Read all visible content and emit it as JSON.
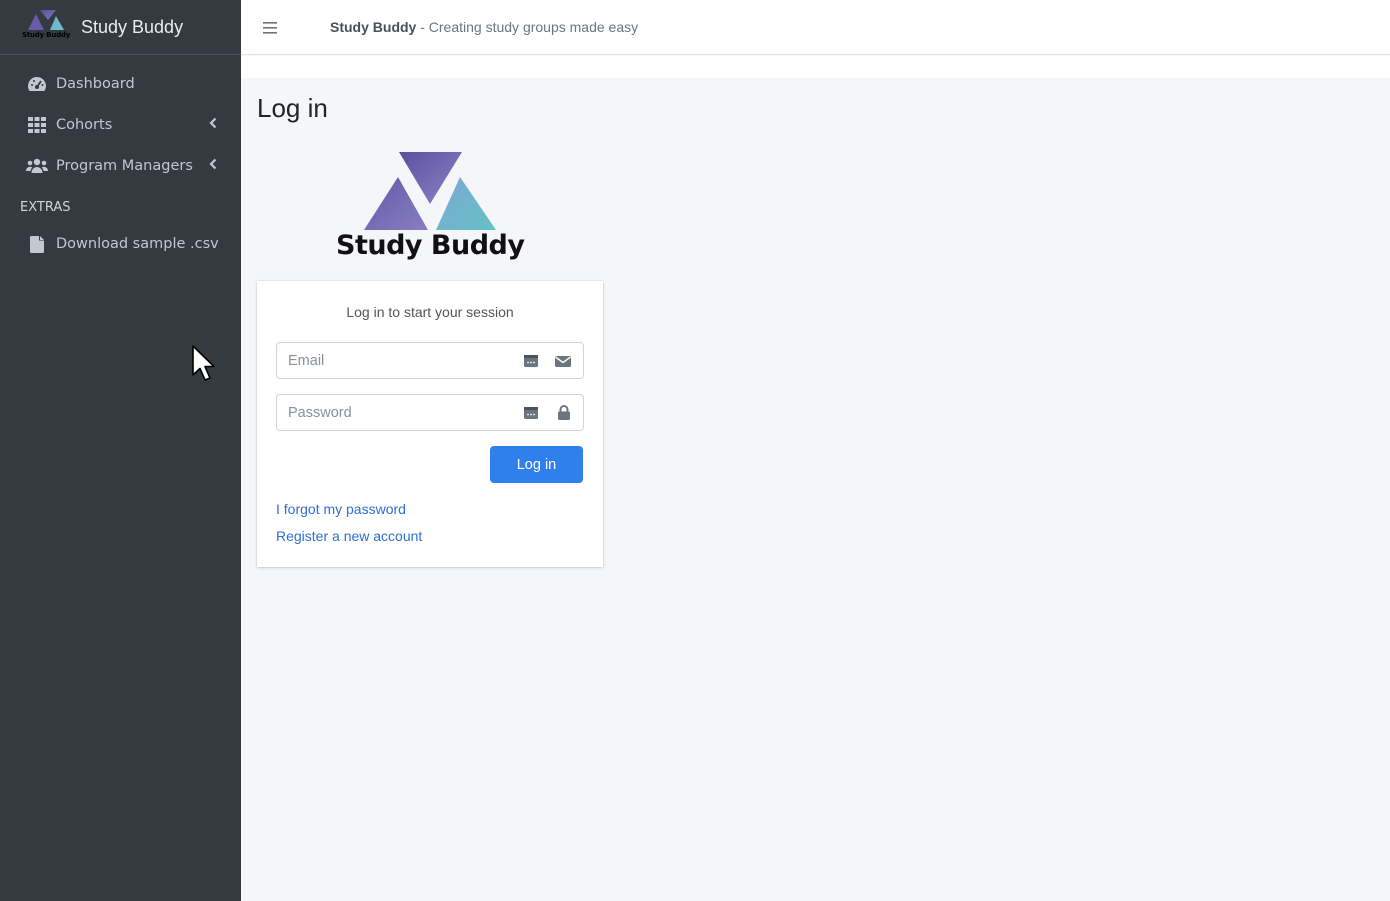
{
  "app": {
    "name": "Study Buddy",
    "logo_text": "Study Buddy"
  },
  "sidebar": {
    "items": [
      {
        "label": "Dashboard",
        "icon": "tachometer-icon"
      },
      {
        "label": "Cohorts",
        "icon": "grid-icon"
      },
      {
        "label": "Program Managers",
        "icon": "users-icon"
      }
    ],
    "extras_header": "EXTRAS",
    "extras": [
      {
        "label": "Download sample .csv",
        "icon": "file-icon"
      }
    ]
  },
  "topbar": {
    "title_strong": "Study Buddy",
    "title_rest": " - Creating study groups made easy"
  },
  "page": {
    "title": "Log in"
  },
  "login": {
    "message": "Log in to start your session",
    "email_placeholder": "Email",
    "password_placeholder": "Password",
    "submit_label": "Log in",
    "forgot_link": "I forgot my password",
    "register_link": "Register a new account"
  },
  "colors": {
    "sidebar_bg": "#343a40",
    "primary": "#2f80ed",
    "link": "#2f6fd6",
    "logo_purple": "#6a5aa8",
    "logo_teal": "#6bbcc8"
  }
}
